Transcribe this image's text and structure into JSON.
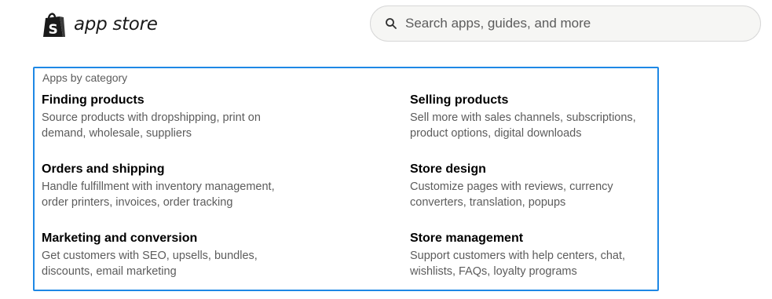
{
  "header": {
    "logo_text": "app store",
    "logo_icon": "shopify-bag-icon",
    "search": {
      "icon": "search-icon",
      "placeholder": "Search apps, guides, and more",
      "value": ""
    }
  },
  "panel": {
    "heading": "Apps by category",
    "border_color": "#1e88e5",
    "categories": [
      {
        "title": "Finding products",
        "description": "Source products with dropshipping, print on demand, wholesale, suppliers"
      },
      {
        "title": "Selling products",
        "description": "Sell more with sales channels, subscriptions, product options, digital downloads"
      },
      {
        "title": "Orders and shipping",
        "description": "Handle fulfillment with inventory management, order printers, invoices, order tracking"
      },
      {
        "title": "Store design",
        "description": "Customize pages with reviews, currency converters, translation, popups"
      },
      {
        "title": "Marketing and conversion",
        "description": "Get customers with SEO, upsells, bundles, discounts, email marketing"
      },
      {
        "title": "Store management",
        "description": "Support customers with help centers, chat, wishlists, FAQs, loyalty programs"
      }
    ]
  }
}
